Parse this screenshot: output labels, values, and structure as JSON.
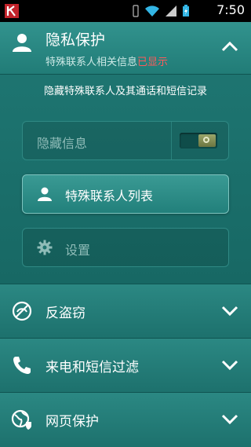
{
  "statusbar": {
    "time": "7:50",
    "icons": [
      "kaspersky-logo-icon",
      "vibrate-icon",
      "wifi-icon",
      "signal-icon",
      "battery-charging-icon"
    ]
  },
  "privacy": {
    "title": "隐私保护",
    "subtitle_prefix": "特殊联系人相关信息",
    "subtitle_status": "已显示",
    "status_color": "#ff5b5b",
    "description": "隐藏特殊联系人及其通话和短信记录",
    "hide_info_label": "隐藏信息",
    "hide_info_enabled": false,
    "contacts_list_label": "特殊联系人列表",
    "settings_label": "设置"
  },
  "sections": [
    {
      "label": "反盗窃",
      "icon": "anti-theft-icon"
    },
    {
      "label": "来电和短信过滤",
      "icon": "phone-icon"
    },
    {
      "label": "网页保护",
      "icon": "web-protection-icon"
    }
  ],
  "colors": {
    "background": "#1c706d",
    "accent": "#2e8b86"
  }
}
